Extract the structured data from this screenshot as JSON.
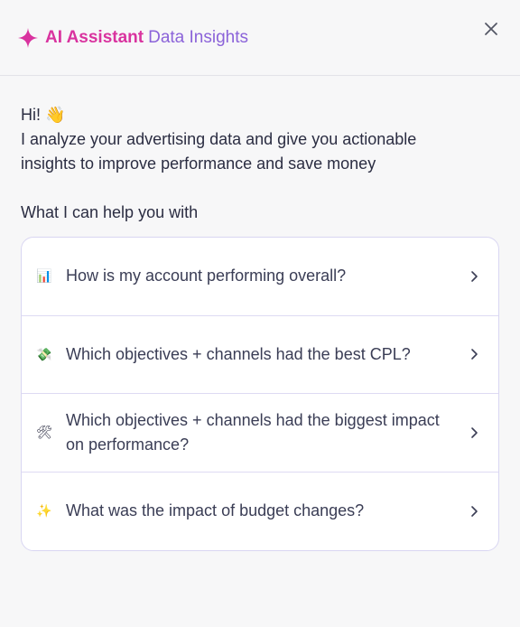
{
  "header": {
    "title_primary": "AI Assistant",
    "title_secondary": "Data Insights"
  },
  "content": {
    "greeting": "Hi! 👋",
    "intro": "I analyze your advertising data and give you actionable insights to improve performance and save money",
    "help_title": "What I can help you with"
  },
  "suggestions": [
    {
      "icon": "bar-chart-icon",
      "emoji": "📊",
      "label": "How is my account performing overall?"
    },
    {
      "icon": "money-wings-icon",
      "emoji": "💸",
      "label": "Which objectives + channels had the best CPL?"
    },
    {
      "icon": "hammer-wrench-icon",
      "emoji": "🛠",
      "label": "Which objectives + channels had the biggest impact on performance?"
    },
    {
      "icon": "sparkles-icon",
      "emoji": "✨",
      "label": "What was the impact of budget changes?"
    }
  ],
  "colors": {
    "brand_pink": "#d9339f",
    "brand_purple": "#8b63d9",
    "card_border": "#d9d6f2"
  }
}
